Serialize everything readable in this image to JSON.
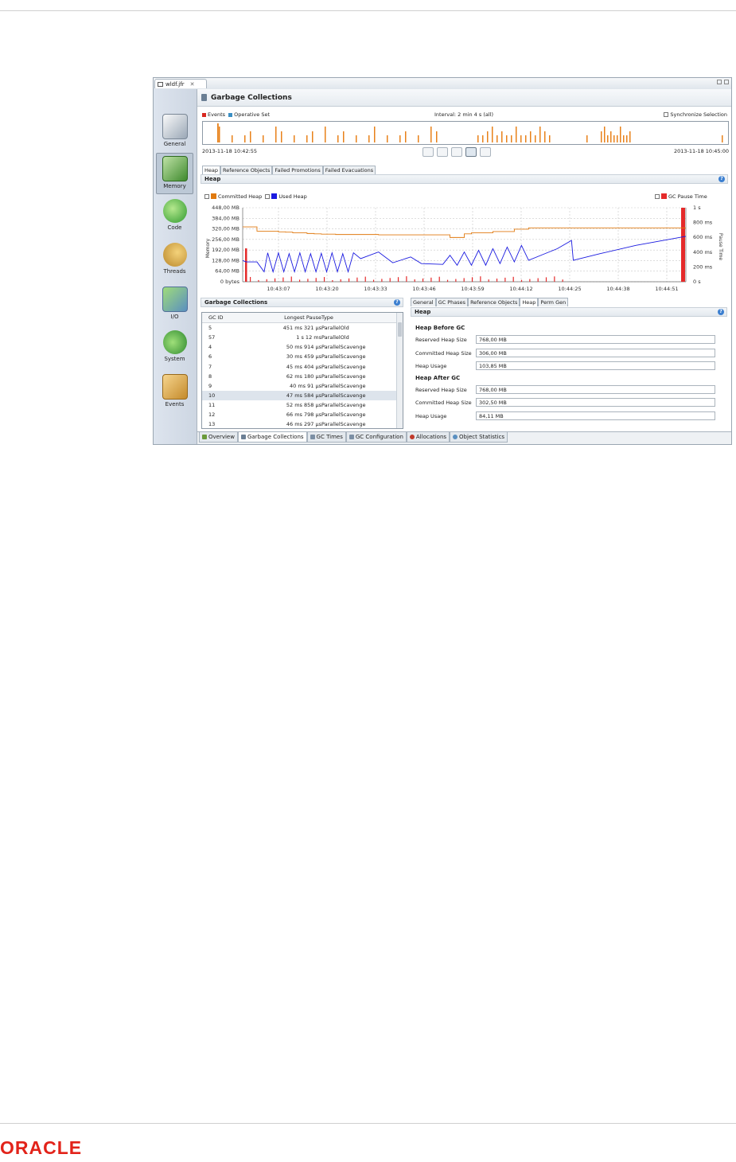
{
  "editor_tab": {
    "label": "wldf.jfr"
  },
  "page_title": "Garbage Collections",
  "sidebar": {
    "items": [
      {
        "label": "General"
      },
      {
        "label": "Memory"
      },
      {
        "label": "Code"
      },
      {
        "label": "Threads"
      },
      {
        "label": "I/O"
      },
      {
        "label": "System"
      },
      {
        "label": "Events"
      }
    ]
  },
  "timeline": {
    "legend_events": "Events",
    "legend_operative": "Operative Set",
    "interval": "Interval: 2 min 4 s (all)",
    "synchronize": "Synchronize Selection",
    "start": "2013-11-18 10:42:55",
    "end": "2013-11-18 10:45:00",
    "colors": {
      "events": "#e8811a",
      "operative": "#3b8fc4"
    }
  },
  "heap_tabs": [
    "Heap",
    "Reference Objects",
    "Failed Promotions",
    "Failed Evacuations"
  ],
  "heap_section": {
    "title": "Heap",
    "help": "?",
    "legend_committed": "Committed Heap",
    "legend_used": "Used Heap",
    "legend_pause": "GC Pause Time",
    "colors": {
      "committed": "#e07a10",
      "used": "#1a1ae0",
      "pause": "#e52a2a"
    }
  },
  "chart_data": {
    "type": "line",
    "xlabel": "",
    "ylabel": "Memory",
    "y2label": "Pause Time",
    "y_ticks": [
      "448,00 MB",
      "384,00 MB",
      "320,00 MB",
      "256,00 MB",
      "192,00 MB",
      "128,00 MB",
      "64,00 MB",
      "0 bytes"
    ],
    "y2_ticks": [
      "1 s",
      "800 ms",
      "600 ms",
      "400 ms",
      "200 ms",
      "0 s"
    ],
    "x_ticks": [
      "10:43:07",
      "10:43:20",
      "10:43:33",
      "10:43:46",
      "10:43:59",
      "10:44:12",
      "10:44:25",
      "10:44:38",
      "10:44:51"
    ],
    "ylim_mb": [
      0,
      448
    ],
    "series": [
      {
        "name": "Committed Heap",
        "t": [
          0,
          2,
          4,
          6,
          8,
          10,
          12,
          14,
          16,
          18,
          20,
          22,
          26,
          30,
          34,
          38,
          42,
          46,
          50,
          54,
          58,
          61,
          62,
          64,
          70,
          76,
          80,
          86,
          95,
          105,
          115,
          124
        ],
        "mb": [
          332,
          332,
          306,
          306,
          306,
          302,
          300,
          296,
          296,
          292,
          290,
          288,
          286,
          286,
          286,
          284,
          284,
          284,
          284,
          284,
          268,
          268,
          290,
          296,
          304,
          318,
          326,
          326,
          326,
          326,
          326,
          326
        ]
      },
      {
        "name": "Used Heap",
        "t": [
          0,
          1,
          4,
          6,
          7,
          8.5,
          10,
          11.5,
          13,
          14.5,
          16,
          17.5,
          19,
          20.5,
          22,
          23.5,
          25,
          26.5,
          28,
          29.5,
          31,
          33,
          38,
          42,
          47,
          50,
          56,
          58,
          60,
          62,
          64,
          66,
          68,
          70,
          72,
          74,
          76,
          78,
          80,
          84,
          88,
          92,
          92.5,
          100,
          110,
          124
        ],
        "mb": [
          128,
          120,
          120,
          60,
          175,
          60,
          175,
          60,
          170,
          60,
          175,
          60,
          170,
          60,
          172,
          60,
          175,
          60,
          170,
          60,
          175,
          140,
          180,
          115,
          150,
          110,
          105,
          160,
          100,
          180,
          100,
          190,
          100,
          200,
          110,
          210,
          120,
          220,
          130,
          165,
          200,
          250,
          130,
          170,
          220,
          275
        ]
      }
    ],
    "pause_ms": [
      {
        "t": 1,
        "ms": 451
      },
      {
        "t": 123,
        "ms": 1000
      }
    ]
  },
  "gc_table": {
    "title": "Garbage Collections",
    "help": "?",
    "columns": [
      "GC ID",
      "Longest Pause",
      "Type"
    ],
    "rows": [
      [
        "5",
        "451 ms 321 µs",
        "ParallelOld"
      ],
      [
        "57",
        "1 s 12 ms",
        "ParallelOld"
      ],
      [
        "4",
        "50 ms 914 µs",
        "ParallelScavenge"
      ],
      [
        "6",
        "30 ms 459 µs",
        "ParallelScavenge"
      ],
      [
        "7",
        "45 ms 404 µs",
        "ParallelScavenge"
      ],
      [
        "8",
        "62 ms 180 µs",
        "ParallelScavenge"
      ],
      [
        "9",
        "40 ms 91 µs",
        "ParallelScavenge"
      ],
      [
        "10",
        "47 ms 584 µs",
        "ParallelScavenge"
      ],
      [
        "11",
        "52 ms 858 µs",
        "ParallelScavenge"
      ],
      [
        "12",
        "66 ms 798 µs",
        "ParallelScavenge"
      ],
      [
        "13",
        "46 ms 297 µs",
        "ParallelScavenge"
      ]
    ],
    "selected_index": 7
  },
  "detail_tabs": [
    "General",
    "GC Phases",
    "Reference Objects",
    "Heap",
    "Perm Gen"
  ],
  "detail": {
    "title": "Heap",
    "help": "?",
    "before_title": "Heap Before GC",
    "after_title": "Heap After GC",
    "reserved_label": "Reserved Heap Size",
    "committed_label": "Committed Heap Size",
    "usage_label": "Heap Usage",
    "before": {
      "reserved": "768,00 MB",
      "committed": "306,00 MB",
      "usage": "103,85 MB"
    },
    "after": {
      "reserved": "768,00 MB",
      "committed": "302,50 MB",
      "usage": "84,11 MB"
    }
  },
  "bottom_tabs": [
    "Overview",
    "Garbage Collections",
    "GC Times",
    "GC Configuration",
    "Allocations",
    "Object Statistics"
  ],
  "logo": "ORACLE"
}
